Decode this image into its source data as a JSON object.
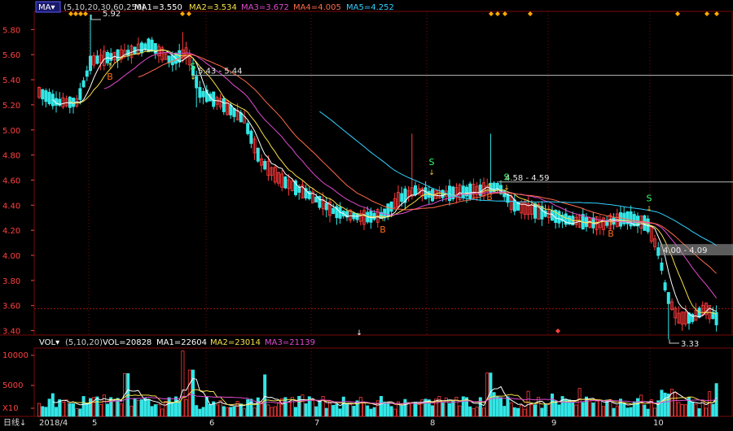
{
  "chart_data": {
    "type": "candlestick",
    "price_axis": {
      "ticks": [
        "5.80",
        "5.60",
        "5.40",
        "5.20",
        "5.00",
        "4.80",
        "4.60",
        "4.40",
        "4.20",
        "4.00",
        "3.80",
        "3.60",
        "3.40"
      ],
      "range": [
        3.33,
        5.92
      ]
    },
    "volume_axis": {
      "ticks": [
        "10000",
        "5000",
        "X10"
      ]
    },
    "time_axis": {
      "labels": [
        "2018/4",
        "5",
        "6",
        "7",
        "8",
        "9",
        "10"
      ]
    },
    "price_header": {
      "menu_label": "MA",
      "params": "(5,10,20,30,60,250)",
      "indicators": [
        {
          "text": "MA1=3.550",
          "color": "#ffffff"
        },
        {
          "text": "MA2=3.534",
          "color": "#f7e04a"
        },
        {
          "text": "MA3=3.672",
          "color": "#e14ad0"
        },
        {
          "text": "MA4=4.005",
          "color": "#ff6b4a"
        },
        {
          "text": "MA5=4.252",
          "color": "#33d0ff"
        }
      ]
    },
    "volume_header": {
      "menu_label": "VOL",
      "params": "(5,10,20)",
      "value": "VOL=20828",
      "indicators": [
        {
          "text": "MA1=22604",
          "color": "#ffffff"
        },
        {
          "text": "MA2=23014",
          "color": "#f7e04a"
        },
        {
          "text": "MA3=21139",
          "color": "#e14ad0"
        }
      ]
    },
    "annotations": [
      {
        "text": "5.92",
        "kind": "high"
      },
      {
        "text": "5.43 - 5.44",
        "kind": "level"
      },
      {
        "text": "4.58 - 4.59",
        "kind": "level"
      },
      {
        "text": "4.00 - 4.09",
        "kind": "level"
      },
      {
        "text": "3.33",
        "kind": "low"
      }
    ],
    "signals": [
      {
        "text": "B",
        "color": "#ff6b1a"
      },
      {
        "text": "S",
        "color": "#33ff66"
      },
      {
        "text": "B",
        "color": "#ff6b1a"
      },
      {
        "text": "S",
        "color": "#33ff66"
      },
      {
        "text": "S",
        "color": "#33ff66"
      },
      {
        "text": "B",
        "color": "#ff6b1a"
      },
      {
        "text": "B",
        "color": "#ff6b1a"
      },
      {
        "text": "S",
        "color": "#33ff66"
      }
    ],
    "colors": {
      "up": "#ff3b3b",
      "down": "#33e6e6",
      "grid": "#7a0a0a",
      "axis_text": "#ff4040",
      "background": "#000000"
    },
    "period_label": "日线"
  }
}
